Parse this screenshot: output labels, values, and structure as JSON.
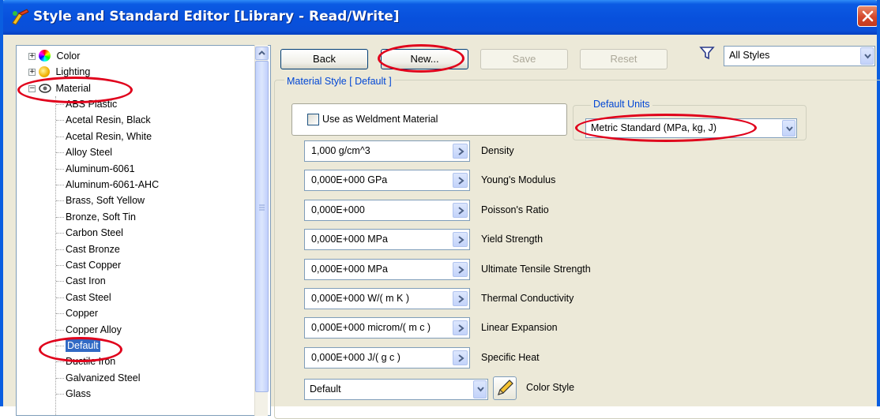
{
  "window": {
    "title": "Style and Standard Editor [Library - Read/Write]"
  },
  "tree": {
    "categories": [
      {
        "label": "Color",
        "expander": "+"
      },
      {
        "label": "Lighting",
        "expander": "+"
      },
      {
        "label": "Material",
        "expander": "−"
      }
    ],
    "materials": [
      "ABS Plastic",
      "Acetal Resin, Black",
      "Acetal Resin, White",
      "Alloy Steel",
      "Aluminum-6061",
      "Aluminum-6061-AHC",
      "Brass, Soft Yellow",
      "Bronze, Soft Tin",
      "Carbon Steel",
      "Cast Bronze",
      "Cast Copper",
      "Cast Iron",
      "Cast Steel",
      "Copper",
      "Copper Alloy",
      "Default",
      "Ductile Iron",
      "Galvanized Steel",
      "Glass"
    ],
    "selected": "Default"
  },
  "toolbar": {
    "back_label": "Back",
    "new_label": "New...",
    "save_label": "Save",
    "reset_label": "Reset",
    "filter_value": "All Styles"
  },
  "material_style": {
    "legend": "Material Style [ Default ]",
    "weldment_label": "Use as Weldment Material",
    "units_legend": "Default Units",
    "units_value": "Metric Standard (MPa, kg, J)",
    "properties": [
      {
        "value": "1,000 g/cm^3",
        "label": "Density"
      },
      {
        "value": "0,000E+000 GPa",
        "label": "Young's Modulus"
      },
      {
        "value": "0,000E+000",
        "label": "Poisson's Ratio"
      },
      {
        "value": "0,000E+000 MPa",
        "label": "Yield Strength"
      },
      {
        "value": "0,000E+000 MPa",
        "label": "Ultimate Tensile Strength"
      },
      {
        "value": "0,000E+000 W/( m K )",
        "label": "Thermal Conductivity"
      },
      {
        "value": "0,000E+000 microm/( m c )",
        "label": "Linear Expansion"
      },
      {
        "value": "0,000E+000 J/( g c )",
        "label": "Specific Heat"
      }
    ],
    "color_style_value": "Default",
    "color_style_label": "Color Style"
  },
  "colors": {
    "titlebar": "#0a4fd8",
    "highlight": "#e0001b",
    "selection": "#316ac5",
    "legend_text": "#0046d5"
  }
}
